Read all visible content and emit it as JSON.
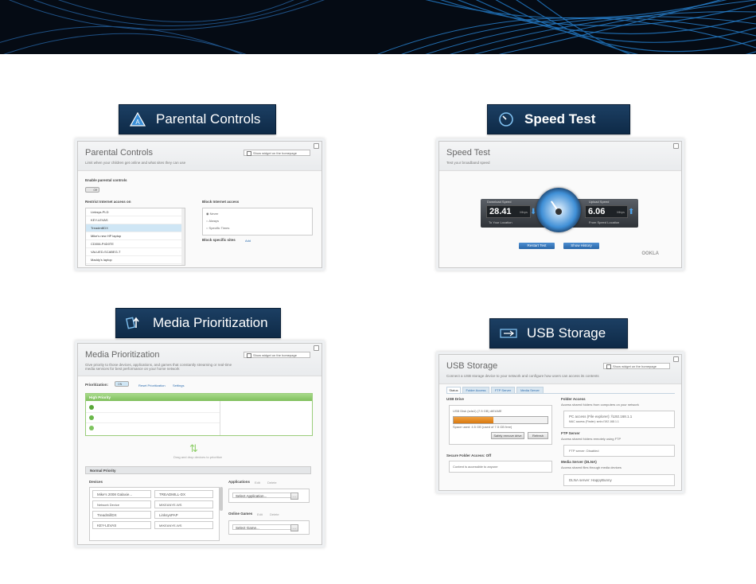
{
  "banner": {
    "colors": {
      "bg": "#050b14",
      "lines": "#1f6fb5"
    }
  },
  "sections": {
    "parental": {
      "tag": "Parental Controls",
      "icon": "parental-controls-icon",
      "shot": {
        "title": "Parental Controls",
        "subtitle": "Limit when your children get online and what sites they can use",
        "widget": "Show widget on the homepage",
        "enable_label": "Enable parental controls",
        "toggle": "Off",
        "restrict_label": "Restrict Internet access on",
        "devices": [
          "Linksys-PLD",
          "KEY-LEVAS",
          "TreadmillDX",
          "Mike's new HP laptop",
          "CD006-P4D0TE",
          "VALUED-SCABEG-T",
          "Maddy's laptop"
        ],
        "block_label": "Block Internet access",
        "block_options": [
          "Never",
          "Always",
          "Specific Times"
        ],
        "block_sites_label": "Block specific sites",
        "add_link": "Add"
      }
    },
    "speed": {
      "tag": "Speed Test",
      "icon": "speedometer-icon",
      "shot": {
        "title": "Speed Test",
        "subtitle": "Test your broadband speed",
        "download_label": "Download Speed",
        "download_value": "28.41",
        "download_unit": "Mbps",
        "download_sub": "To Your Location",
        "upload_label": "Upload Speed",
        "upload_value": "6.06",
        "upload_unit": "Mbps",
        "upload_sub": "From Speed Location",
        "restart": "Restart Test",
        "history": "Show History",
        "logo": "OOKLA"
      }
    },
    "media": {
      "tag": "Media Prioritization",
      "icon": "media-prioritization-icon",
      "shot": {
        "title": "Media Prioritization",
        "subtitle": "Give priority to those devices, applications, and games that constantly streaming or real-time media services for best performance on your home network",
        "widget": "Show widget on the homepage",
        "prio_label": "Prioritization:",
        "toggle": "ON",
        "link_reset": "Reset Prioritization",
        "link_settings": "Settings",
        "high_priority": "High Priority",
        "drag_hint": "Drag and drop devices to prioritize",
        "normal_priority": "Normal Priority",
        "devices_label": "Devices",
        "devices": [
          "Mike's 2008 Galaxie...",
          "TREADMILL-DX",
          "Network Device",
          "MIKEANYE-WS",
          "TreadmillDX",
          "LinksysPAP",
          "KEY-LEVAS",
          "MIKEANYE-WS"
        ],
        "applications_label": "Applications",
        "app_edit": "Edit",
        "app_delete": "Delete",
        "select_app": "Select Application...",
        "games_label": "Online Games",
        "game_edit": "Edit",
        "game_delete": "Delete",
        "select_game": "Select Game..."
      }
    },
    "usb": {
      "tag": "USB Storage",
      "icon": "usb-icon",
      "shot": {
        "title": "USB Storage",
        "subtitle": "Connect a USB storage device to your network and configure how users can access its contents",
        "widget": "Show widget on the homepage",
        "tabs": [
          "Status",
          "Folder Access",
          "FTP Server",
          "Media Server"
        ],
        "drive_label": "USB Drive",
        "drive_name": "USB Disk (sda1) (7.5 GB) dtEAME",
        "drive_usage": "Space used: 4.5 GB (used of 7.5 GB free)",
        "safely_remove": "Safely remove drive",
        "refresh": "Refresh",
        "usage_percent": 42,
        "folder_label": "Folder Access",
        "folder_sub": "Access shared folders from computers on your network",
        "folder_text": "PC access (File explorer): \\\\192.168.1.1",
        "folder_text2": "MAC access (Finder): smb://192.168.1.1",
        "secure_label": "Secure Folder Access: Off",
        "secure_text": "Content is accessible to anyone",
        "ftp_label": "FTP Server",
        "ftp_sub": "Access shared folders remotely using FTP",
        "ftp_text": "FTP server: Disabled",
        "dlna_label": "Media Server (DLNA)",
        "dlna_sub": "Access shared files through media devices",
        "dlna_text": "DLNA server: HappyBunny"
      }
    }
  }
}
